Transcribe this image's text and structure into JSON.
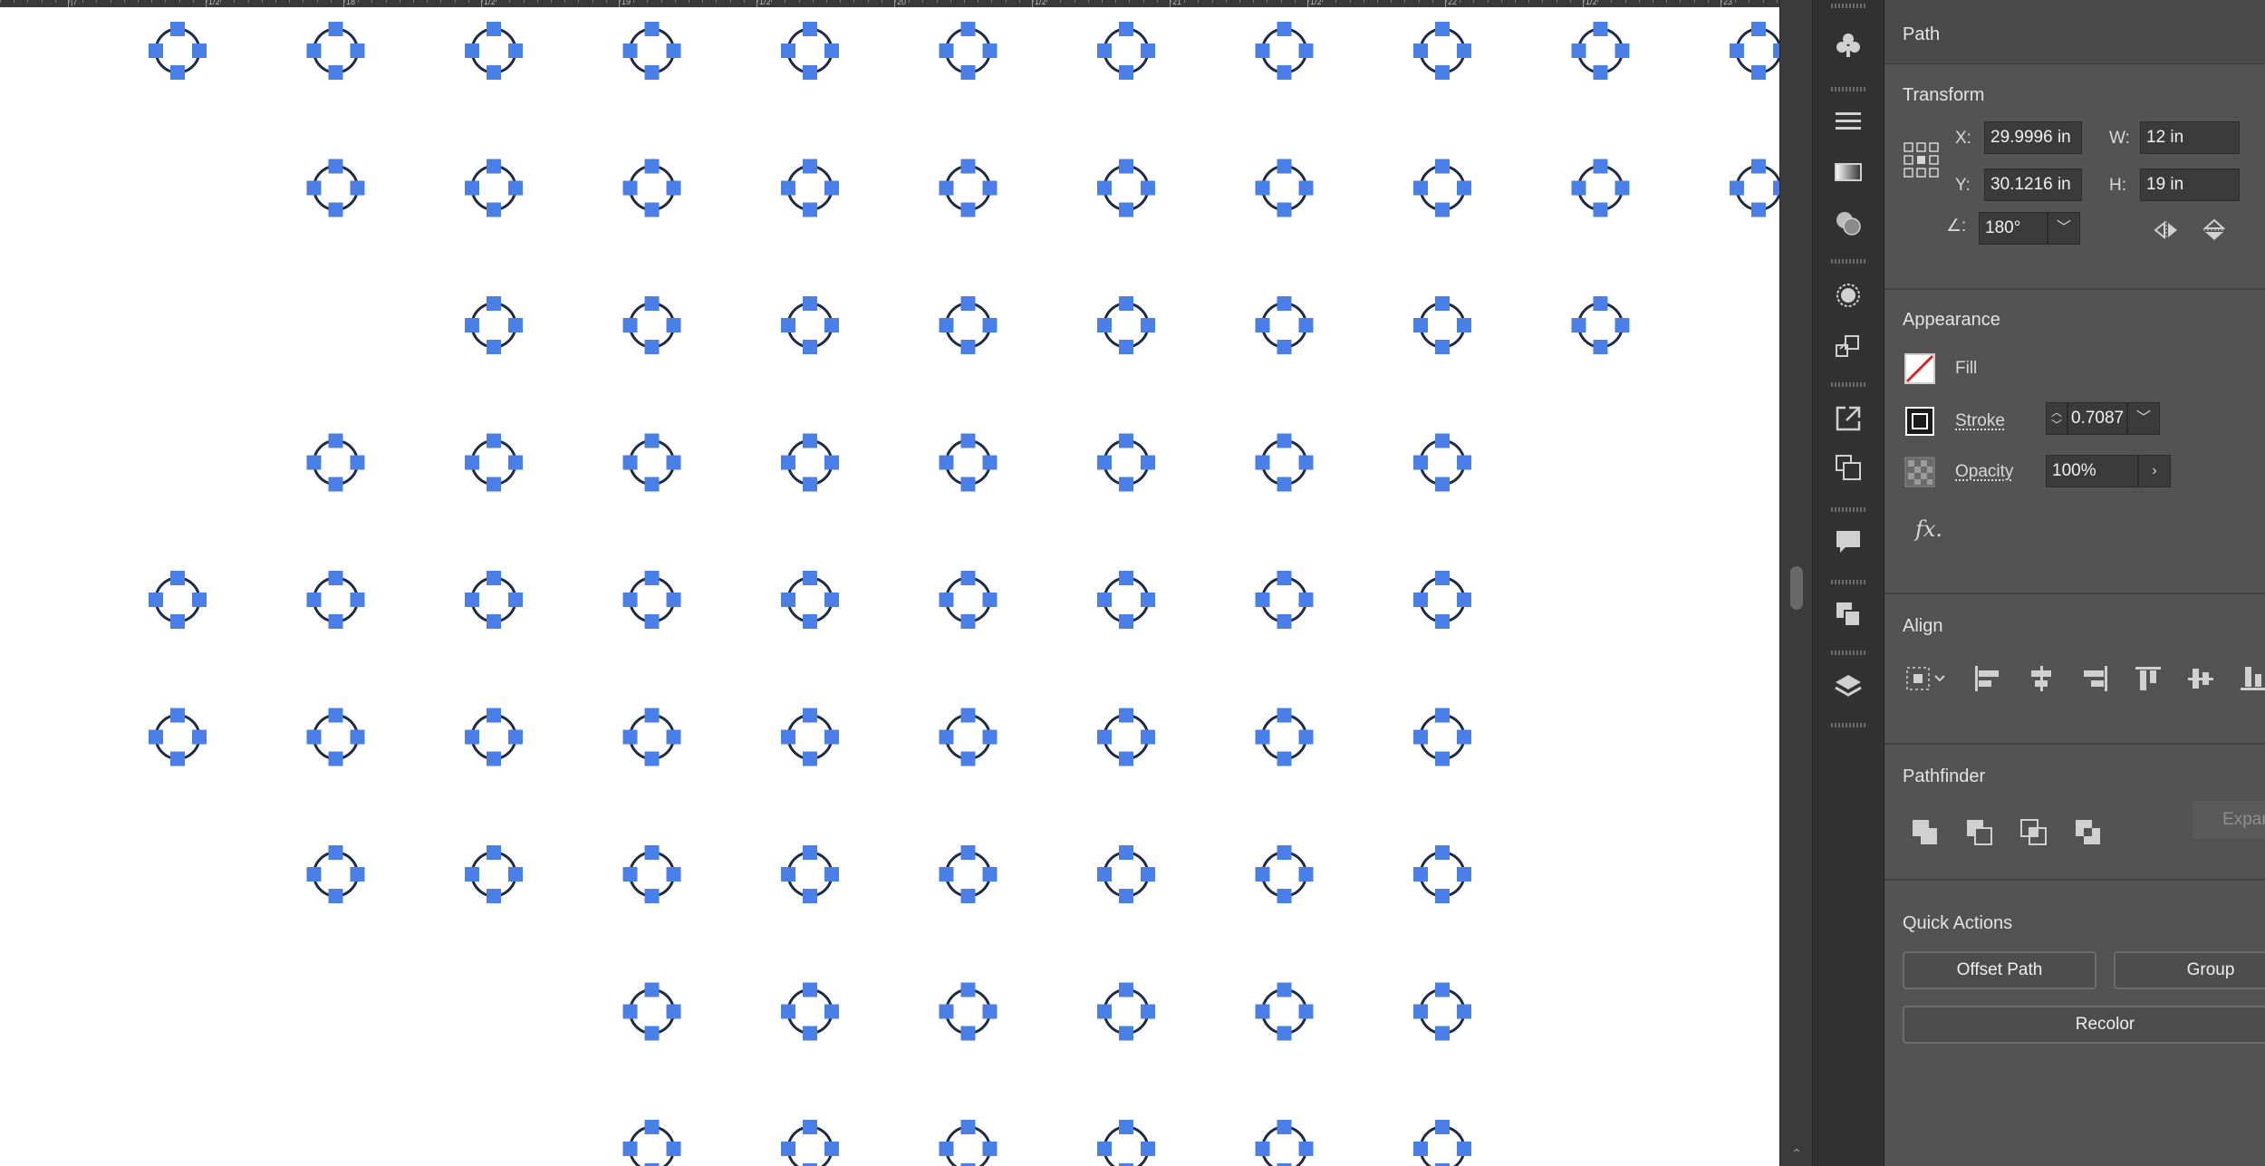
{
  "ruler": {
    "labels": [
      "|7",
      "1/2",
      "18",
      "1/2",
      "19",
      "1/2",
      "20",
      "1/2",
      "21",
      "1/2",
      "22",
      "1/2",
      "23"
    ]
  },
  "artboard": {
    "shape_name": "circle-anchor",
    "stroke_color": "#1f2a44",
    "anchor_color": "#4a7fe8",
    "rows": [
      [
        0,
        1,
        2,
        3,
        4,
        5,
        6,
        7,
        8,
        9,
        10
      ],
      [
        1,
        2,
        3,
        4,
        5,
        6,
        7,
        8,
        9,
        10
      ],
      [
        2,
        3,
        4,
        5,
        6,
        7,
        8,
        9
      ],
      [
        1,
        2,
        3,
        4,
        5,
        6,
        7,
        8
      ],
      [
        0,
        1,
        2,
        3,
        4,
        5,
        6,
        7,
        8
      ],
      [
        0,
        1,
        2,
        3,
        4,
        5,
        6,
        7,
        8
      ],
      [
        1,
        2,
        3,
        4,
        5,
        6,
        7,
        8
      ],
      [
        3,
        4,
        5,
        6,
        7,
        8
      ],
      [
        3,
        4,
        5,
        6,
        7,
        8
      ]
    ]
  },
  "iconbar": {
    "icons": [
      "symbols-icon",
      "stroke-lines-icon",
      "gradient-icon",
      "transparency-icon",
      "appearance-circle-icon",
      "transform-icon",
      "export-icon",
      "arrange-icon",
      "comments-icon",
      "pathfinder-icon",
      "layers-icon"
    ]
  },
  "panel": {
    "title": "Path",
    "transform": {
      "title": "Transform",
      "x_label": "X:",
      "x_value": "29.9996 in",
      "y_label": "Y:",
      "y_value": "30.1216 in",
      "w_label": "W:",
      "w_value": "12 in",
      "h_label": "H:",
      "h_value": "19 in",
      "angle_label": "∠:",
      "angle_value": "180°"
    },
    "appearance": {
      "title": "Appearance",
      "fill_label": "Fill",
      "stroke_label": "Stroke",
      "stroke_value": "0.7087",
      "opacity_label": "Opacity",
      "opacity_value": "100%",
      "fx_label": "fx."
    },
    "align": {
      "title": "Align"
    },
    "pathfinder": {
      "title": "Pathfinder",
      "expand_label": "Expan"
    },
    "quick_actions": {
      "title": "Quick Actions",
      "offset_path": "Offset Path",
      "group": "Group",
      "recolor": "Recolor"
    }
  }
}
